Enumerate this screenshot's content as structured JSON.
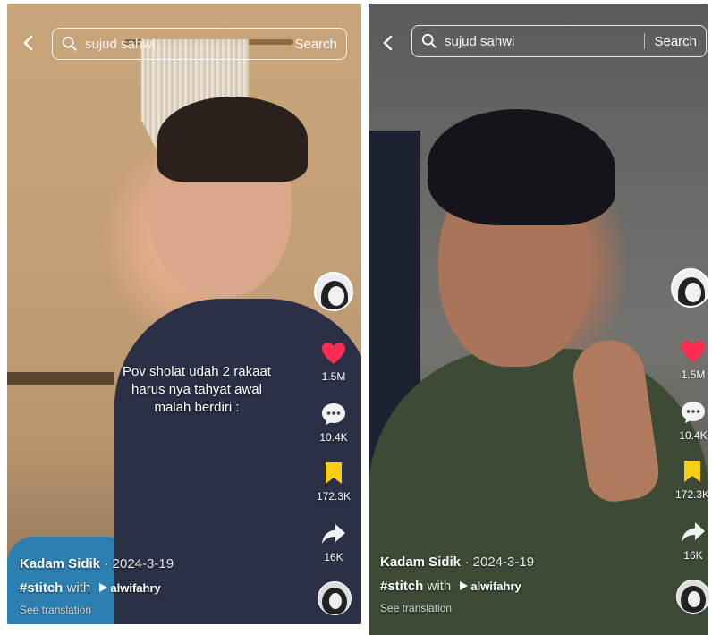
{
  "screens": [
    {
      "search": {
        "query": "sujud sahwi",
        "button": "Search"
      },
      "caption": [
        "Pov sholat udah 2 rakaat",
        "harus nya tahyat awal",
        "malah berdiri :"
      ],
      "actions": {
        "likes": "1.5M",
        "comments": "10.4K",
        "saves": "172.3K",
        "shares": "16K"
      },
      "author": {
        "username": "Kadam Sidik",
        "date": "· 2024-3-19"
      },
      "hashtag": "#stitch",
      "with_label": "with",
      "stitch_partner": "alwifahry",
      "translation": "See translation"
    },
    {
      "search": {
        "query": "sujud sahwi",
        "button": "Search"
      },
      "caption": [],
      "actions": {
        "likes": "1.5M",
        "comments": "10.4K",
        "saves": "172.3K",
        "shares": "16K"
      },
      "author": {
        "username": "Kadam Sidik",
        "date": "· 2024-3-19"
      },
      "hashtag": "#stitch",
      "with_label": "with",
      "stitch_partner": "alwifahry",
      "translation": "See translation"
    }
  ],
  "colors": {
    "like": "#fe2c55",
    "save": "#face15",
    "text": "#ffffff"
  },
  "icons": [
    "back-arrow-icon",
    "search-icon",
    "heart-icon",
    "comment-icon",
    "bookmark-icon",
    "share-icon",
    "play-icon"
  ]
}
